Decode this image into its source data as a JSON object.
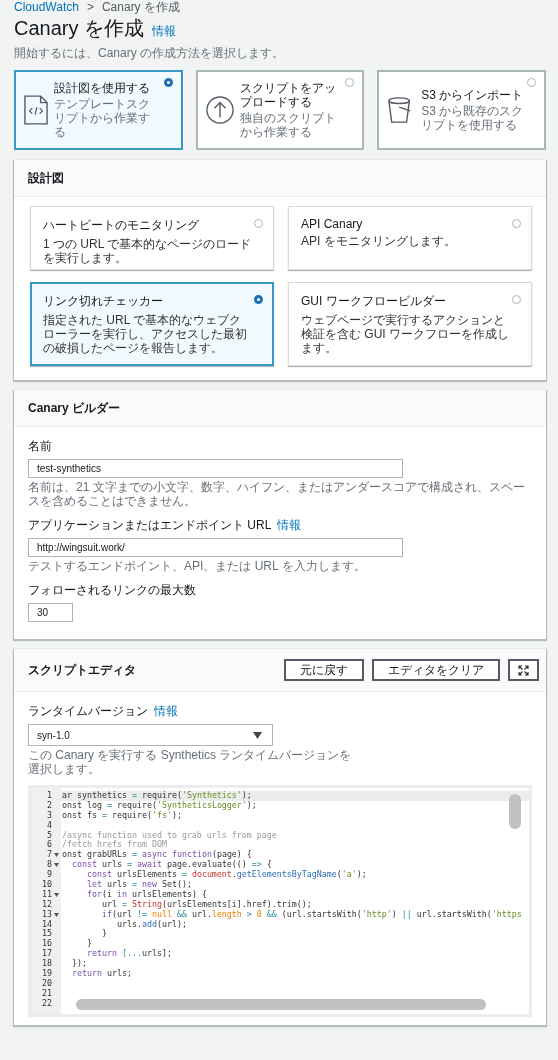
{
  "breadcrumb": {
    "separator": ">",
    "items": [
      {
        "label": "CloudWatch"
      },
      {
        "label": "Canary を作成"
      }
    ]
  },
  "page": {
    "title": "Canary を作成",
    "info_link": "情報",
    "description": "開始するには、Canary の作成方法を選択します。"
  },
  "methods": [
    {
      "kind": "document",
      "title": "設計図を使用する",
      "description": "テンプレートスクリプトから作業する",
      "selected": true
    },
    {
      "kind": "upload",
      "title": "スクリプトをアップロードする",
      "description": "独自のスクリプトから作業する",
      "selected": false
    },
    {
      "kind": "bucket",
      "title": "S3 からインポート",
      "description": "S3 から既存のスクリプトを使用する",
      "selected": false
    }
  ],
  "blueprints": {
    "title": "設計図",
    "options": [
      {
        "title": "ハートビートのモニタリング",
        "description": "1 つの URL で基本的なページのロードを実行します。",
        "selected": false
      },
      {
        "title": "API Canary",
        "description": "API をモニタリングします。",
        "selected": false
      },
      {
        "title": "リンク切れチェッカー",
        "description": "指定された URL で基本的なウェブクローラーを実行し、アクセスした最初の破損したページを報告します。",
        "selected": true
      },
      {
        "title": "GUI ワークフロービルダー",
        "description": "ウェブページで実行するアクションと検証を含む GUI ワークフローを作成します。",
        "selected": false
      }
    ]
  },
  "builder": {
    "title": "Canary ビルダー",
    "fields": [
      {
        "kind": "text",
        "label": "名前",
        "value": "test-synthetics",
        "hint": "名前は、21 文字までの小文字、数字、ハイフン、またはアンダースコアで構成され、スペースを含めることはできません。"
      },
      {
        "kind": "text",
        "label": "アプリケーションまたはエンドポイント URL",
        "info_link": "情報",
        "value": "http://wingsuit.work/",
        "hint": "テストするエンドポイント、API、または URL を入力します。"
      },
      {
        "kind": "number",
        "label": "フォローされるリンクの最大数",
        "value": "30"
      }
    ]
  },
  "editor": {
    "title": "スクリプトエディタ",
    "buttons": [
      "元に戻す",
      "エディタをクリア"
    ],
    "runtime": {
      "label": "ランタイムバージョン",
      "info_link": "情報",
      "value": "syn-1.0",
      "hint": "この Canary を実行する Synthetics ランタイムバージョンを選択します。"
    },
    "lines": [
      {
        "number": "1",
        "active": true,
        "fold": false,
        "tokens": [
          {
            "kind": "plain",
            "text": "ar synthetics"
          },
          {
            "kind": "op",
            "text": " = "
          },
          {
            "kind": "plain",
            "text": "require("
          },
          {
            "kind": "string",
            "text": "'Synthetics'"
          },
          {
            "kind": "plain",
            "text": ");"
          }
        ]
      },
      {
        "number": "2",
        "active": false,
        "fold": false,
        "tokens": [
          {
            "kind": "plain",
            "text": "onst log"
          },
          {
            "kind": "op",
            "text": " = "
          },
          {
            "kind": "plain",
            "text": "require("
          },
          {
            "kind": "string",
            "text": "'SyntheticsLogger'"
          },
          {
            "kind": "plain",
            "text": ");"
          }
        ]
      },
      {
        "number": "3",
        "active": false,
        "fold": false,
        "tokens": [
          {
            "kind": "plain",
            "text": "onst fs"
          },
          {
            "kind": "op",
            "text": " = "
          },
          {
            "kind": "plain",
            "text": "require("
          },
          {
            "kind": "string",
            "text": "'fs'"
          },
          {
            "kind": "plain",
            "text": ");"
          }
        ]
      },
      {
        "number": "4",
        "active": false,
        "fold": false
      },
      {
        "number": "5",
        "active": false,
        "fold": false,
        "tokens": [
          {
            "kind": "comment",
            "text": "/async function used to grab urls from page"
          }
        ]
      },
      {
        "number": "6",
        "active": false,
        "fold": false,
        "tokens": [
          {
            "kind": "comment",
            "text": "/fetch hrefs from DOM"
          }
        ]
      },
      {
        "number": "7",
        "active": false,
        "fold": true,
        "tokens": [
          {
            "kind": "plain",
            "text": "onst grabURLs"
          },
          {
            "kind": "op",
            "text": " = "
          },
          {
            "kind": "keyword",
            "text": "async"
          },
          {
            "kind": "keyword",
            "text": " function"
          },
          {
            "kind": "plain",
            "text": "(page) {"
          }
        ]
      },
      {
        "number": "8",
        "active": false,
        "fold": true,
        "tokens": [
          {
            "kind": "keyword",
            "text": "  const"
          },
          {
            "kind": "plain",
            "text": " urls"
          },
          {
            "kind": "op",
            "text": " = "
          },
          {
            "kind": "keyword",
            "text": "await"
          },
          {
            "kind": "plain",
            "text": " page.evaluate(()"
          },
          {
            "kind": "op",
            "text": " => "
          },
          {
            "kind": "plain",
            "text": "{"
          }
        ]
      },
      {
        "number": "9",
        "active": false,
        "fold": false,
        "tokens": [
          {
            "kind": "keyword",
            "text": "     const"
          },
          {
            "kind": "plain",
            "text": " urlsElements"
          },
          {
            "kind": "op",
            "text": " = "
          },
          {
            "kind": "variable",
            "text": "document"
          },
          {
            "kind": "plain",
            "text": "."
          },
          {
            "kind": "function",
            "text": "getElementsByTagName"
          },
          {
            "kind": "plain",
            "text": "("
          },
          {
            "kind": "string",
            "text": "'a'"
          },
          {
            "kind": "plain",
            "text": ");"
          }
        ]
      },
      {
        "number": "10",
        "active": false,
        "fold": false,
        "tokens": [
          {
            "kind": "keyword",
            "text": "     let"
          },
          {
            "kind": "plain",
            "text": " urls"
          },
          {
            "kind": "op",
            "text": " = "
          },
          {
            "kind": "keyword",
            "text": "new"
          },
          {
            "kind": "plain",
            "text": " Set();"
          }
        ]
      },
      {
        "number": "11",
        "active": false,
        "fold": true,
        "tokens": [
          {
            "kind": "keyword",
            "text": "     for"
          },
          {
            "kind": "plain",
            "text": "(i"
          },
          {
            "kind": "keyword",
            "text": " in"
          },
          {
            "kind": "plain",
            "text": " urlsElements) {"
          }
        ]
      },
      {
        "number": "12",
        "active": false,
        "fold": false,
        "tokens": [
          {
            "kind": "plain",
            "text": "        url"
          },
          {
            "kind": "op",
            "text": " = "
          },
          {
            "kind": "variable",
            "text": "String"
          },
          {
            "kind": "plain",
            "text": "(urlsElements[i].href).trim();"
          }
        ]
      },
      {
        "number": "13",
        "active": false,
        "fold": true,
        "tokens": [
          {
            "kind": "keyword",
            "text": "        if"
          },
          {
            "kind": "plain",
            "text": "(url"
          },
          {
            "kind": "op",
            "text": " != "
          },
          {
            "kind": "number",
            "text": "null"
          },
          {
            "kind": "op",
            "text": " && "
          },
          {
            "kind": "plain",
            "text": "url."
          },
          {
            "kind": "number",
            "text": "length"
          },
          {
            "kind": "op",
            "text": " > "
          },
          {
            "kind": "number",
            "text": "0"
          },
          {
            "kind": "op",
            "text": " && "
          },
          {
            "kind": "plain",
            "text": "(url.startsWith("
          },
          {
            "kind": "string",
            "text": "'http'"
          },
          {
            "kind": "plain",
            "text": ")"
          },
          {
            "kind": "op",
            "text": " || "
          },
          {
            "kind": "plain",
            "text": "url.startsWith("
          },
          {
            "kind": "string",
            "text": "'https"
          }
        ]
      },
      {
        "number": "14",
        "active": false,
        "fold": false,
        "tokens": [
          {
            "kind": "plain",
            "text": "           urls."
          },
          {
            "kind": "function",
            "text": "add"
          },
          {
            "kind": "plain",
            "text": "(url);"
          }
        ]
      },
      {
        "number": "15",
        "active": false,
        "fold": false,
        "tokens": [
          {
            "kind": "plain",
            "text": "        }"
          }
        ]
      },
      {
        "number": "16",
        "active": false,
        "fold": false,
        "tokens": [
          {
            "kind": "plain",
            "text": "     }"
          }
        ]
      },
      {
        "number": "17",
        "active": false,
        "fold": false,
        "tokens": [
          {
            "kind": "keyword",
            "text": "     return"
          },
          {
            "kind": "op",
            "text": " [..."
          },
          {
            "kind": "plain",
            "text": "urls];"
          }
        ]
      },
      {
        "number": "18",
        "active": false,
        "fold": false,
        "tokens": [
          {
            "kind": "plain",
            "text": "  });"
          }
        ]
      },
      {
        "number": "19",
        "active": false,
        "fold": false,
        "tokens": [
          {
            "kind": "keyword",
            "text": "  return"
          },
          {
            "kind": "plain",
            "text": " urls;"
          }
        ]
      },
      {
        "number": "20",
        "active": false,
        "fold": false
      },
      {
        "number": "21",
        "active": false,
        "fold": false
      },
      {
        "number": "22",
        "active": false,
        "fold": false
      }
    ]
  }
}
